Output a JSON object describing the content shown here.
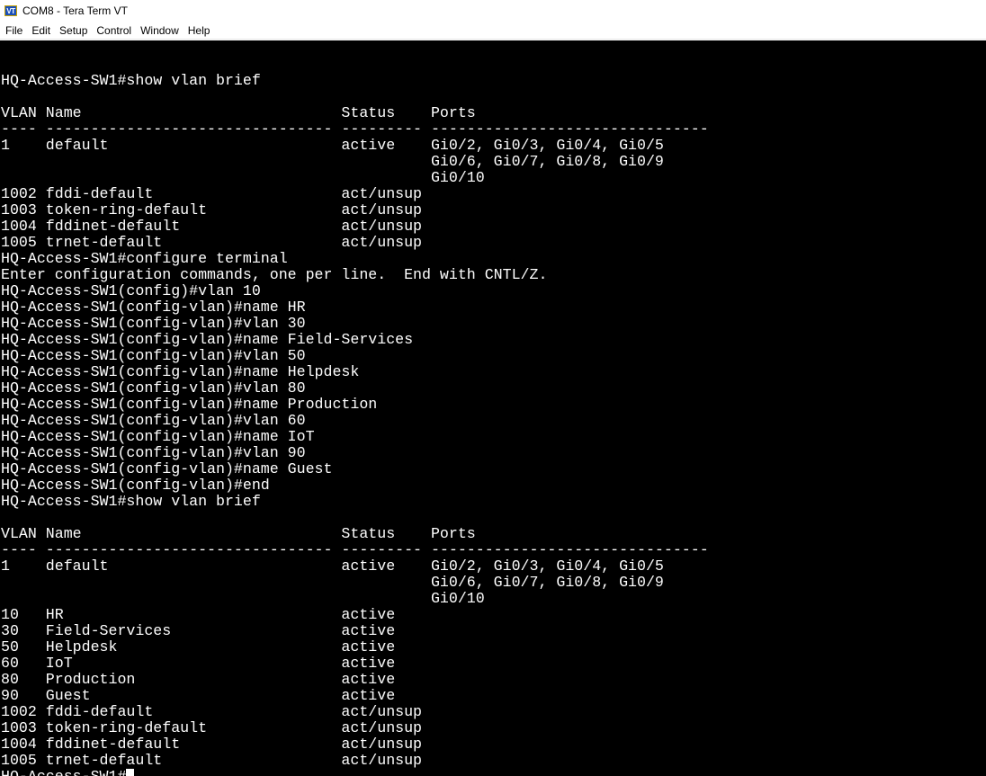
{
  "window": {
    "title": "COM8 - Tera Term VT",
    "icon": "VT"
  },
  "menu": {
    "items": [
      "File",
      "Edit",
      "Setup",
      "Control",
      "Window",
      "Help"
    ]
  },
  "terminal": {
    "lines": [
      "",
      "HQ-Access-SW1#show vlan brief",
      "",
      "VLAN Name                             Status    Ports",
      "---- -------------------------------- --------- -------------------------------",
      "1    default                          active    Gi0/2, Gi0/3, Gi0/4, Gi0/5",
      "                                                Gi0/6, Gi0/7, Gi0/8, Gi0/9",
      "                                                Gi0/10",
      "1002 fddi-default                     act/unsup",
      "1003 token-ring-default               act/unsup",
      "1004 fddinet-default                  act/unsup",
      "1005 trnet-default                    act/unsup",
      "HQ-Access-SW1#configure terminal",
      "Enter configuration commands, one per line.  End with CNTL/Z.",
      "HQ-Access-SW1(config)#vlan 10",
      "HQ-Access-SW1(config-vlan)#name HR",
      "HQ-Access-SW1(config-vlan)#vlan 30",
      "HQ-Access-SW1(config-vlan)#name Field-Services",
      "HQ-Access-SW1(config-vlan)#vlan 50",
      "HQ-Access-SW1(config-vlan)#name Helpdesk",
      "HQ-Access-SW1(config-vlan)#vlan 80",
      "HQ-Access-SW1(config-vlan)#name Production",
      "HQ-Access-SW1(config-vlan)#vlan 60",
      "HQ-Access-SW1(config-vlan)#name IoT",
      "HQ-Access-SW1(config-vlan)#vlan 90",
      "HQ-Access-SW1(config-vlan)#name Guest",
      "HQ-Access-SW1(config-vlan)#end",
      "HQ-Access-SW1#show vlan brief",
      "",
      "VLAN Name                             Status    Ports",
      "---- -------------------------------- --------- -------------------------------",
      "1    default                          active    Gi0/2, Gi0/3, Gi0/4, Gi0/5",
      "                                                Gi0/6, Gi0/7, Gi0/8, Gi0/9",
      "                                                Gi0/10",
      "10   HR                               active",
      "30   Field-Services                   active",
      "50   Helpdesk                         active",
      "60   IoT                              active",
      "80   Production                       active",
      "90   Guest                            active",
      "1002 fddi-default                     act/unsup",
      "1003 token-ring-default               act/unsup",
      "1004 fddinet-default                  act/unsup",
      "1005 trnet-default                    act/unsup"
    ],
    "prompt": "HQ-Access-SW1#"
  }
}
